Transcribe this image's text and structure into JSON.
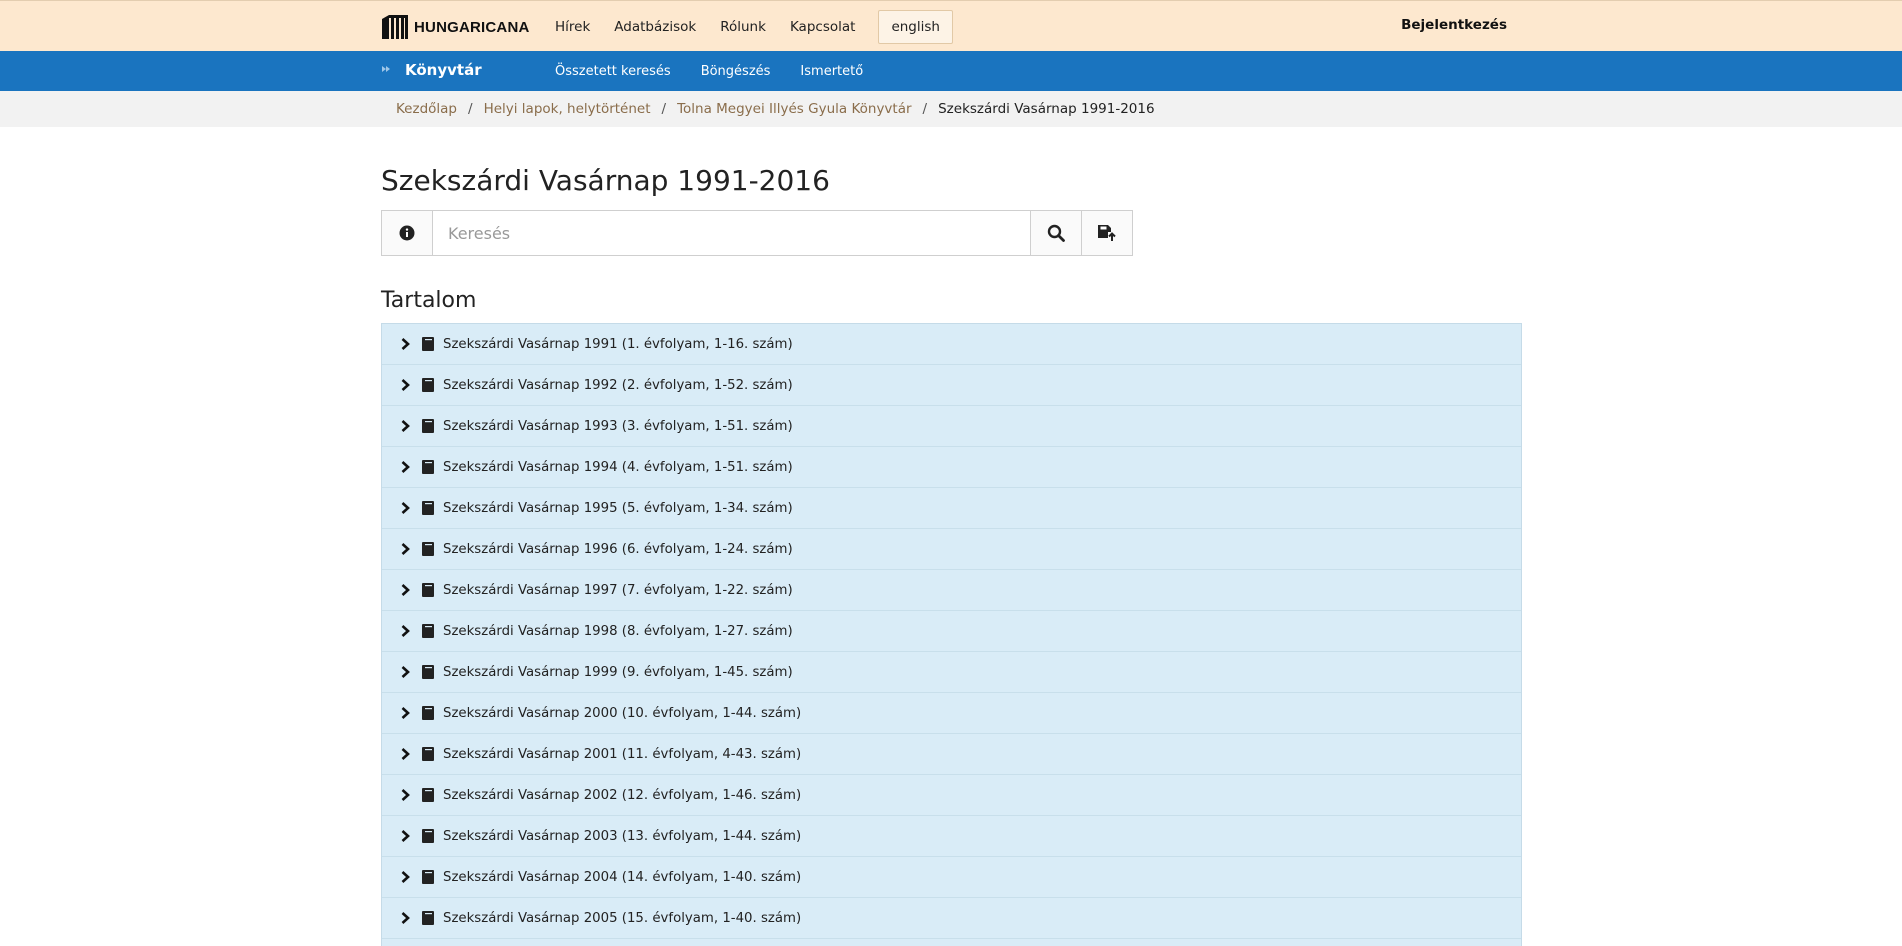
{
  "header": {
    "logo_text": "HUNGARICANA",
    "nav": [
      "Hírek",
      "Adatbázisok",
      "Rólunk",
      "Kapcsolat"
    ],
    "language": "english",
    "login": "Bejelentkezés"
  },
  "section": {
    "title": "Könyvtár",
    "nav": [
      "Összetett keresés",
      "Böngészés",
      "Ismertető"
    ]
  },
  "breadcrumb": {
    "items": [
      "Kezdőlap",
      "Helyi lapok, helytörténet",
      "Tolna Megyei Illyés Gyula Könyvtár"
    ],
    "current": "Szekszárdi Vasárnap 1991-2016",
    "separator": "/"
  },
  "page_title": "Szekszárdi Vasárnap 1991-2016",
  "search": {
    "placeholder": "Keresés"
  },
  "content": {
    "title": "Tartalom",
    "items": [
      "Szekszárdi Vasárnap 1991 (1. évfolyam, 1-16. szám)",
      "Szekszárdi Vasárnap 1992 (2. évfolyam, 1-52. szám)",
      "Szekszárdi Vasárnap 1993 (3. évfolyam, 1-51. szám)",
      "Szekszárdi Vasárnap 1994 (4. évfolyam, 1-51. szám)",
      "Szekszárdi Vasárnap 1995 (5. évfolyam, 1-34. szám)",
      "Szekszárdi Vasárnap 1996 (6. évfolyam, 1-24. szám)",
      "Szekszárdi Vasárnap 1997 (7. évfolyam, 1-22. szám)",
      "Szekszárdi Vasárnap 1998 (8. évfolyam, 1-27. szám)",
      "Szekszárdi Vasárnap 1999 (9. évfolyam, 1-45. szám)",
      "Szekszárdi Vasárnap 2000 (10. évfolyam, 1-44. szám)",
      "Szekszárdi Vasárnap 2001 (11. évfolyam, 4-43. szám)",
      "Szekszárdi Vasárnap 2002 (12. évfolyam, 1-46. szám)",
      "Szekszárdi Vasárnap 2003 (13. évfolyam, 1-44. szám)",
      "Szekszárdi Vasárnap 2004 (14. évfolyam, 1-40. szám)",
      "Szekszárdi Vasárnap 2005 (15. évfolyam, 1-40. szám)"
    ]
  },
  "icons": {
    "logo": "hungaricana-logo-icon",
    "section": "section-arrow-icon",
    "info": "info-icon",
    "search": "search-icon",
    "save": "save-search-icon",
    "expand": "chevron-right-icon",
    "item": "book-icon"
  },
  "colors": {
    "header_bg": "#fde8cf",
    "section_bar": "#1a74bf",
    "breadcrumb_link": "#8a6d4b",
    "list_row_bg": "#d9ecf7"
  }
}
